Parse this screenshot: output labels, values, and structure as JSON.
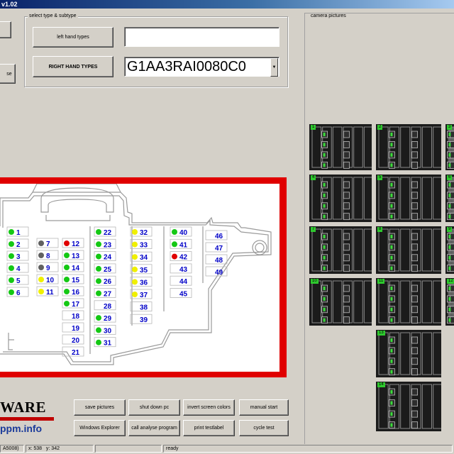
{
  "window": {
    "title": "v1.02"
  },
  "type_group": {
    "label": "select type & subtype",
    "left_button": "left hand types",
    "right_button": "RIGHT HAND TYPES",
    "left_field_value": "",
    "combo_value": "G1AA3RAI0080C0"
  },
  "left_partial": {
    "button2_fragment": "se"
  },
  "camera_panel": {
    "label": "camera pictures"
  },
  "logo": {
    "brand": "WARE",
    "url": "ppm.info"
  },
  "buttons": {
    "save_pictures": "save pictures",
    "shut_down_pc": "shut down pc",
    "invert_screen_colors": "invert screen colors",
    "manual_start": "manual start",
    "windows_explorer": "Windows Explorer",
    "call_analyse_program": "call analyse program",
    "print_testlabel": "print testlabel",
    "cycle_test": "cycle test"
  },
  "statusbar": {
    "p1": "A5008)",
    "x": "x: 538",
    "y": "y: 342",
    "status": "ready"
  },
  "colors": {
    "green": "#14c814",
    "yellow": "#f0f000",
    "red": "#e00000",
    "grey": "#606060",
    "number": "#0000c8"
  },
  "fuses": [
    {
      "n": "1",
      "s": "green"
    },
    {
      "n": "2",
      "s": "green"
    },
    {
      "n": "3",
      "s": "green"
    },
    {
      "n": "4",
      "s": "green"
    },
    {
      "n": "5",
      "s": "green"
    },
    {
      "n": "6",
      "s": "green"
    },
    {
      "n": "7",
      "s": "grey"
    },
    {
      "n": "8",
      "s": "grey"
    },
    {
      "n": "9",
      "s": "grey"
    },
    {
      "n": "10",
      "s": "yellow"
    },
    {
      "n": "11",
      "s": "yellow"
    },
    {
      "n": "12",
      "s": "red"
    },
    {
      "n": "13",
      "s": "green"
    },
    {
      "n": "14",
      "s": "green"
    },
    {
      "n": "15",
      "s": "green"
    },
    {
      "n": "16",
      "s": "green"
    },
    {
      "n": "17",
      "s": "green"
    },
    {
      "n": "18",
      "s": "none"
    },
    {
      "n": "19",
      "s": "none"
    },
    {
      "n": "20",
      "s": "none"
    },
    {
      "n": "21",
      "s": "none"
    },
    {
      "n": "22",
      "s": "green"
    },
    {
      "n": "23",
      "s": "green"
    },
    {
      "n": "24",
      "s": "green"
    },
    {
      "n": "25",
      "s": "green"
    },
    {
      "n": "26",
      "s": "green"
    },
    {
      "n": "27",
      "s": "green"
    },
    {
      "n": "28",
      "s": "none"
    },
    {
      "n": "29",
      "s": "green"
    },
    {
      "n": "30",
      "s": "green"
    },
    {
      "n": "31",
      "s": "green"
    },
    {
      "n": "32",
      "s": "yellow"
    },
    {
      "n": "33",
      "s": "yellow"
    },
    {
      "n": "34",
      "s": "yellow"
    },
    {
      "n": "35",
      "s": "yellow"
    },
    {
      "n": "36",
      "s": "yellow"
    },
    {
      "n": "37",
      "s": "yellow"
    },
    {
      "n": "38",
      "s": "none"
    },
    {
      "n": "39",
      "s": "none"
    },
    {
      "n": "40",
      "s": "green"
    },
    {
      "n": "41",
      "s": "green"
    },
    {
      "n": "42",
      "s": "red"
    },
    {
      "n": "43",
      "s": "none"
    },
    {
      "n": "44",
      "s": "none"
    },
    {
      "n": "45",
      "s": "none"
    },
    {
      "n": "46",
      "s": "none"
    },
    {
      "n": "47",
      "s": "none"
    },
    {
      "n": "48",
      "s": "none"
    },
    {
      "n": "49",
      "s": "none"
    }
  ],
  "cameras": [
    {
      "tag": "1"
    },
    {
      "tag": "2"
    },
    {
      "tag": "3"
    },
    {
      "tag": "4"
    },
    {
      "tag": "5"
    },
    {
      "tag": "6"
    },
    {
      "tag": "7"
    },
    {
      "tag": "8"
    },
    {
      "tag": "9"
    },
    {
      "tag": "10"
    },
    {
      "tag": "11"
    },
    {
      "tag": "12"
    },
    {
      "tag": "13"
    },
    {
      "tag": "14"
    }
  ]
}
